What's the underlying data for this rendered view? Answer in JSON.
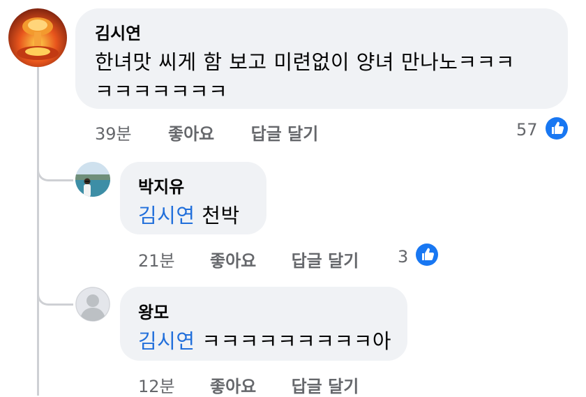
{
  "comments": [
    {
      "author": "김시연",
      "lines": [
        "한녀맛 씨게 함 보고 미련없이 양녀 만나노ㅋㅋㅋ",
        "ㅋㅋㅋㅋㅋㅋㅋ"
      ],
      "time": "39분",
      "like_label": "좋아요",
      "reply_label": "답글 달기",
      "reaction_count": "57",
      "accent": "#1877f2"
    }
  ],
  "replies": [
    {
      "author": "박지유",
      "mention": "김시연",
      "text": " 천박",
      "time": "21분",
      "like_label": "좋아요",
      "reply_label": "답글 달기",
      "reaction_count": "3"
    },
    {
      "author": "왕모",
      "mention": "김시연",
      "text": " ㅋㅋㅋㅋㅋㅋㅋㅋㅋ아",
      "time": "12분",
      "like_label": "좋아요",
      "reply_label": "답글 달기"
    }
  ],
  "icons": {
    "reaction": "thumbs-up-icon",
    "avatar_1": "explosion-avatar",
    "avatar_2": "beach-photo-avatar",
    "avatar_3": "default-user-avatar"
  },
  "colors": {
    "bubble": "#f0f2f5",
    "mention": "#216fdb",
    "meta": "#65676b",
    "like_badge": "#1877f2"
  }
}
